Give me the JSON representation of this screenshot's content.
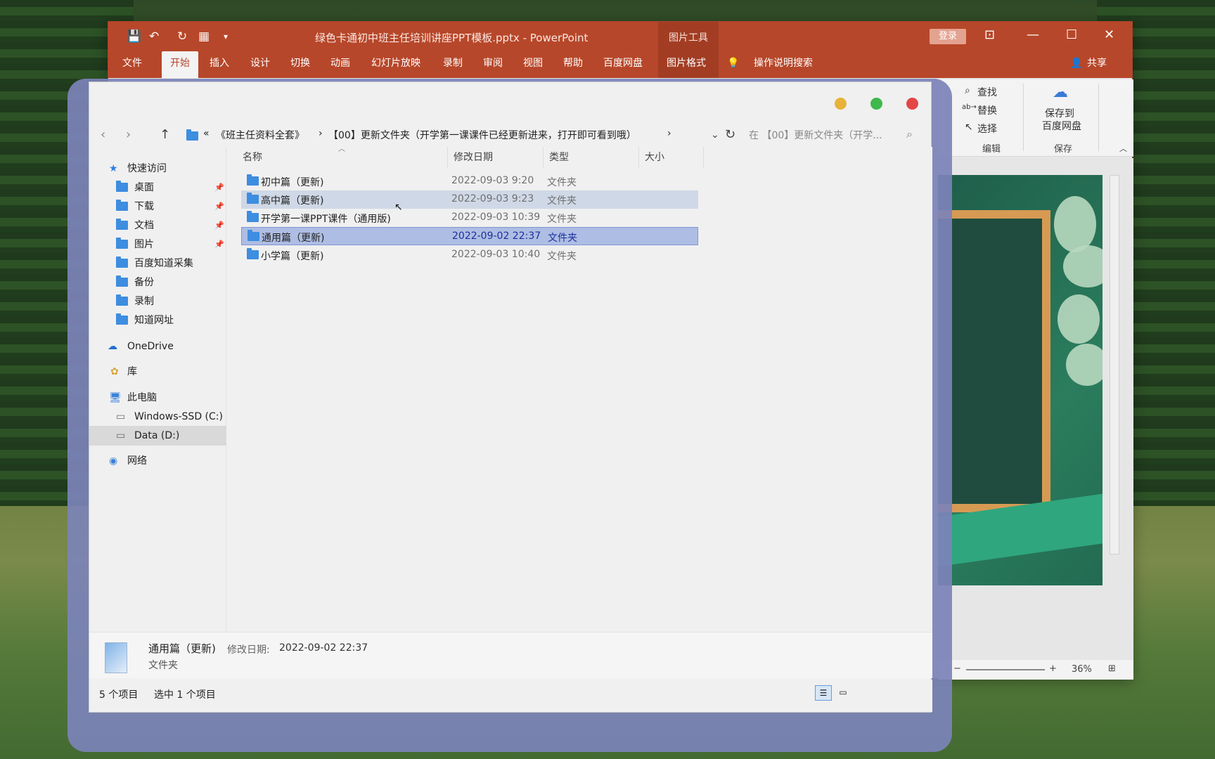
{
  "ppt": {
    "title": "绿色卡通初中班主任培训讲座PPT模板.pptx  -  PowerPoint",
    "tools_tab": "图片工具",
    "login": "登录",
    "tabs": [
      "文件",
      "开始",
      "插入",
      "设计",
      "切换",
      "动画",
      "幻灯片放映",
      "录制",
      "审阅",
      "视图",
      "帮助",
      "百度网盘",
      "图片格式"
    ],
    "tell_me": "操作说明搜索",
    "share": "共享",
    "ribbon": {
      "find": "查找",
      "replace": "替换",
      "select": "选择",
      "edit_group": "编辑",
      "save_to_line1": "保存到",
      "save_to_line2": "百度网盘",
      "save_group": "保存"
    },
    "zoom": "36%"
  },
  "explorer": {
    "breadcrumb": [
      "«",
      "《班主任资料全套》",
      "›",
      "【00】更新文件夹（开学第一课课件已经更新进来，打开即可看到哦）",
      "›"
    ],
    "search_placeholder": "在 【00】更新文件夹（开学...",
    "sidebar": [
      {
        "label": "快速访问",
        "icon": "star-icon"
      },
      {
        "label": "桌面",
        "icon": "folder-icon",
        "pinned": true
      },
      {
        "label": "下载",
        "icon": "folder-icon",
        "pinned": true
      },
      {
        "label": "文档",
        "icon": "folder-icon",
        "pinned": true
      },
      {
        "label": "图片",
        "icon": "folder-icon",
        "pinned": true
      },
      {
        "label": "百度知道采集",
        "icon": "folder-icon"
      },
      {
        "label": "备份",
        "icon": "folder-icon"
      },
      {
        "label": "录制",
        "icon": "folder-icon"
      },
      {
        "label": "知道网址",
        "icon": "folder-icon"
      },
      {
        "label": "OneDrive",
        "icon": "cloud-icon"
      },
      {
        "label": "库",
        "icon": "library-icon"
      },
      {
        "label": "此电脑",
        "icon": "computer-icon"
      },
      {
        "label": "Windows-SSD (C:)",
        "icon": "drive-icon"
      },
      {
        "label": "Data (D:)",
        "icon": "drive-icon"
      },
      {
        "label": "网络",
        "icon": "network-icon"
      }
    ],
    "columns": [
      "名称",
      "修改日期",
      "类型",
      "大小"
    ],
    "files": [
      {
        "name": "初中篇（更新)",
        "date": "2022-09-03 9:20",
        "type": "文件夹"
      },
      {
        "name": "高中篇（更新)",
        "date": "2022-09-03 9:23",
        "type": "文件夹"
      },
      {
        "name": "开学第一课PPT课件（通用版)",
        "date": "2022-09-03 10:39",
        "type": "文件夹"
      },
      {
        "name": "通用篇（更新)",
        "date": "2022-09-02 22:37",
        "type": "文件夹"
      },
      {
        "name": "小学篇（更新)",
        "date": "2022-09-03 10:40",
        "type": "文件夹"
      }
    ],
    "details": {
      "name": "通用篇（更新)",
      "date_label": "修改日期:",
      "date": "2022-09-02 22:37",
      "type": "文件夹"
    },
    "status": {
      "count": "5 个项目",
      "selected": "选中 1 个项目"
    }
  }
}
